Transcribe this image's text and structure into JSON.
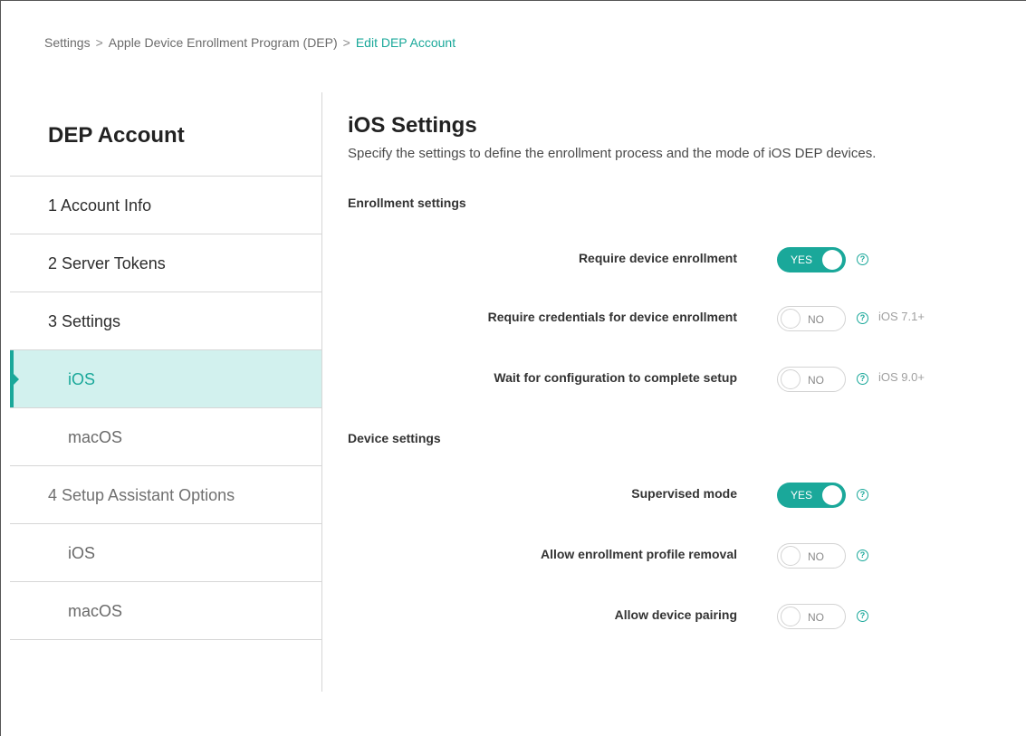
{
  "breadcrumb": {
    "items": [
      "Settings",
      "Apple Device Enrollment Program (DEP)"
    ],
    "separator": ">",
    "current": "Edit DEP Account"
  },
  "sidebar": {
    "title": "DEP Account",
    "items": [
      {
        "label": "1  Account Info"
      },
      {
        "label": "2  Server Tokens"
      },
      {
        "label": "3  Settings"
      },
      {
        "label": "iOS",
        "active": true
      },
      {
        "label": "macOS"
      },
      {
        "label": "4  Setup Assistant Options"
      },
      {
        "label": "iOS"
      },
      {
        "label": "macOS"
      }
    ]
  },
  "main": {
    "title": "iOS Settings",
    "description": "Specify the settings to define the enrollment process and the mode of iOS DEP devices.",
    "enrollment_heading": "Enrollment settings",
    "device_heading": "Device settings",
    "settings": [
      {
        "label": "Require device enrollment",
        "toggle": "YES",
        "on": true,
        "help": "?",
        "version": ""
      },
      {
        "label": "Require credentials for device enrollment",
        "toggle": "NO",
        "on": false,
        "help": "?",
        "version": "iOS 7.1+"
      },
      {
        "label": "Wait for configuration to complete setup",
        "toggle": "NO",
        "on": false,
        "help": "?",
        "version": "iOS 9.0+"
      },
      {
        "label": "Supervised mode",
        "toggle": "YES",
        "on": true,
        "help": "?",
        "version": ""
      },
      {
        "label": "Allow enrollment profile removal",
        "toggle": "NO",
        "on": false,
        "help": "?",
        "version": ""
      },
      {
        "label": "Allow device pairing",
        "toggle": "NO",
        "on": false,
        "help": "?",
        "version": ""
      }
    ]
  },
  "colors": {
    "accent": "#1aa89a",
    "active_bg": "#d2f1ee"
  }
}
